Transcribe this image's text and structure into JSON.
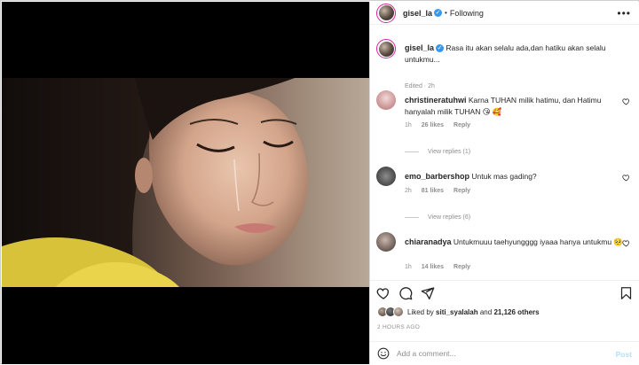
{
  "post": {
    "username": "gisel_la",
    "follow_label": "Following",
    "more_label": "•••"
  },
  "caption": {
    "username": "gisel_la",
    "text": "Rasa itu akan selalu ada,dan hatiku akan selalu untukmu...",
    "meta": "Edited · 2h"
  },
  "comments": [
    {
      "username": "christineratuhwi",
      "text": "Karna TUHAN milik hatimu, dan Hatimu hanyalah milik TUHAN 😘 🥰",
      "time": "1h",
      "likes": "26 likes",
      "reply": "Reply"
    },
    {
      "username": "emo_barbershop",
      "text": "Untuk mas gading?",
      "time": "2h",
      "likes": "81 likes",
      "reply": "Reply",
      "view_replies": "View replies (1)"
    },
    {
      "username": "chiaranadya",
      "text": "Untukmuuu taehyungggg iyaaa hanya untukmu 🥺",
      "time": "1h",
      "likes": "14 likes",
      "reply": "Reply",
      "view_replies": "View replies (6)"
    }
  ],
  "engagement": {
    "liked_prefix": "Liked by",
    "liked_user": "siti_syalalah",
    "liked_and": "and",
    "liked_count": "21,126 others",
    "time_ago": "2 HOURS AGO"
  },
  "add_comment": {
    "placeholder": "Add a comment...",
    "post_label": "Post"
  },
  "icons": {
    "like": "heart-icon",
    "comment": "comment-bubble-icon",
    "share": "paper-plane-icon",
    "save": "bookmark-icon",
    "emoji": "smiley-icon",
    "verified": "verified-badge-icon"
  },
  "colors": {
    "verified": "#3897f0",
    "muted": "#8e8e8e",
    "post_disabled": "#b2dffc",
    "story_ring": "#d6249f"
  }
}
